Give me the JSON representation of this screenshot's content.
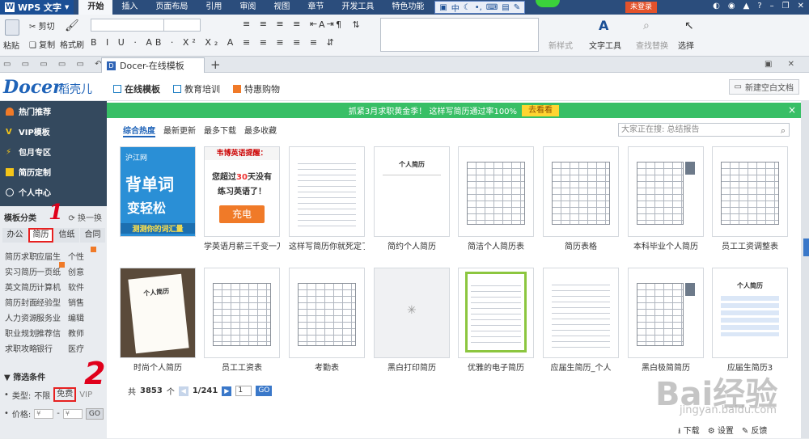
{
  "app": {
    "name": "WPS 文字",
    "login_label": "未登录"
  },
  "menu": {
    "items": [
      "开始",
      "插入",
      "页面布局",
      "引用",
      "审阅",
      "视图",
      "章节",
      "开发工具",
      "特色功能"
    ],
    "active": 0
  },
  "ime": {
    "label": "中"
  },
  "ribbon": {
    "paste": "粘贴",
    "cut": "剪切",
    "copy": "复制",
    "format_painter": "格式刷",
    "new_style": "新样式",
    "text_tools": "文字工具",
    "find_replace": "查找替换",
    "select": "选择"
  },
  "doc_tab": {
    "title": "Docer-在线模板",
    "add": "+"
  },
  "docer": {
    "brand": "Docer",
    "brand_cn": "稻壳儿",
    "tabs": [
      "在线模板",
      "教育培训",
      "特惠购物"
    ],
    "new_blank": "新建空白文档"
  },
  "sidebar": {
    "nav": [
      "热门推荐",
      "VIP模板",
      "包月专区",
      "简历定制",
      "个人中心"
    ],
    "category_title": "模板分类",
    "switch_label": "换一换",
    "category_tabs": [
      "办公",
      "简历",
      "信纸",
      "合同"
    ],
    "active_category": 1,
    "tags": [
      [
        "简历求职",
        "应届生",
        "个性"
      ],
      [
        "实习简历",
        "一页纸",
        "创意"
      ],
      [
        "英文简历",
        "计算机",
        "软件"
      ],
      [
        "简历封面",
        "经验型",
        "销售"
      ],
      [
        "人力资源",
        "服务业",
        "编辑"
      ],
      [
        "职业规划",
        "推荐信",
        "教师"
      ],
      [
        "求职攻略",
        "银行",
        "医疗"
      ]
    ],
    "hot_tags": [
      "个性",
      "一页纸"
    ],
    "filter_title": "筛选条件",
    "type_label": "类型:",
    "type_options": [
      "不限",
      "免费",
      "VIP"
    ],
    "type_selected": "免费",
    "price_label": "价格:",
    "price_placeholder": "¥",
    "price_dash": "-",
    "go_label": "GO"
  },
  "annotations": [
    "1",
    "2"
  ],
  "promo": {
    "text": "抓紧3月求职黄金季！ 这样写简历通过率100%",
    "button": "去看看",
    "close": "×"
  },
  "sort_tabs": [
    "综合热度",
    "最新更新",
    "最多下载",
    "最多收藏"
  ],
  "search": {
    "placeholder": "大家正在搜: 总结报告"
  },
  "templates": [
    {
      "title": "",
      "kind": "ad-blue",
      "ad_lines": [
        "沪江网",
        "背单词",
        "变轻松",
        "测测你的词汇量"
      ]
    },
    {
      "title": "学英语月薪三千变一万",
      "kind": "ad-white",
      "ad_lines": [
        "韦博英语提醒：",
        "您超过",
        "30",
        "天没有",
        "练习英语了！",
        "充电"
      ]
    },
    {
      "title": "这样写简历你就死定了",
      "kind": "lines"
    },
    {
      "title": "简约个人简历",
      "kind": "title",
      "doc_heading": "个人简历"
    },
    {
      "title": "简洁个人简历表",
      "kind": "grid"
    },
    {
      "title": "简历表格",
      "kind": "grid"
    },
    {
      "title": "本科毕业个人简历",
      "kind": "grid-photo"
    },
    {
      "title": "员工工资调整表",
      "kind": "grid"
    },
    {
      "title": "时尚个人简历",
      "kind": "photo-desk",
      "doc_heading": "个人简历"
    },
    {
      "title": "员工工资表",
      "kind": "grid"
    },
    {
      "title": "考勤表",
      "kind": "grid"
    },
    {
      "title": "黑白打印简历",
      "kind": "loading"
    },
    {
      "title": "优雅的电子简历",
      "kind": "green"
    },
    {
      "title": "应届生简历_个人",
      "kind": "lines"
    },
    {
      "title": "黑白极简简历",
      "kind": "grid-photo"
    },
    {
      "title": "应届生简历3",
      "kind": "title-blue",
      "doc_heading": "个人简历"
    }
  ],
  "pager": {
    "total_prefix": "共",
    "total": "3853",
    "total_suffix": "个",
    "page": "1/241",
    "input": "1",
    "go": "GO",
    "prev": "◀",
    "next": "▶"
  },
  "bottom": {
    "download": "下载",
    "settings": "设置",
    "feedback": "反馈"
  },
  "watermark": {
    "main": "Bai经验",
    "sub": "jingyan.baidu.com"
  },
  "colors": {
    "menubar": "#2b4d7c",
    "sidebar": "#34495e",
    "promo": "#38bf66",
    "accent": "#1f63b8",
    "annotation": "#e0001b"
  }
}
